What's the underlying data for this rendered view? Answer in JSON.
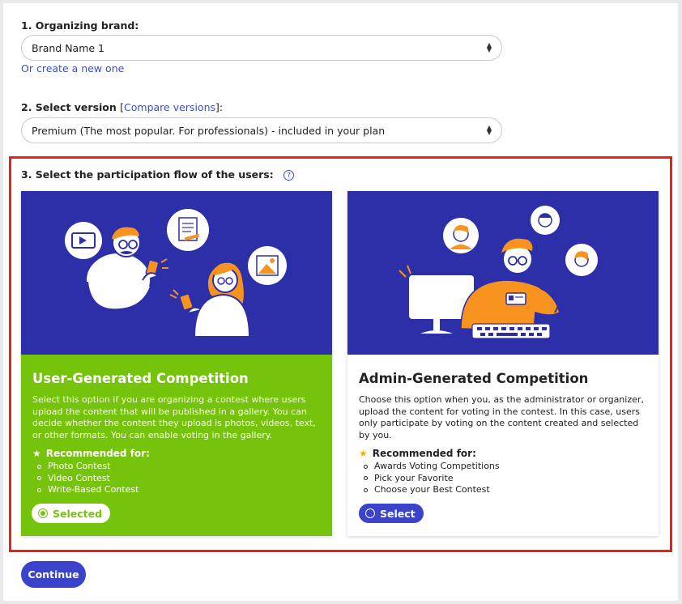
{
  "brand": {
    "label": "1. Organizing brand:",
    "selected": "Brand Name 1",
    "create_link": "Or create a new one"
  },
  "version": {
    "label": "2. Select version",
    "compare_open": "[",
    "compare_link": "Compare versions",
    "compare_close": "]:",
    "selected": "Premium (The most popular. For professionals) - included in your plan"
  },
  "flow": {
    "label": "3. Select the participation flow of the users:",
    "help": "?",
    "cards": [
      {
        "title": "User-Generated Competition",
        "description": "Select this option if you are organizing a contest where users upload the content that will be published in a gallery. You can decide whether the content they upload is photos, videos, text, or other formats. You can enable voting in the gallery.",
        "recommended_label": "Recommended for:",
        "items": [
          "Photo Contest",
          "Video Contest",
          "Write-Based Contest"
        ],
        "button": "Selected",
        "state": "selected"
      },
      {
        "title": "Admin-Generated Competition",
        "description": "Choose this option when you, as the administrator or organizer, upload the content for voting in the contest. In this case, users only participate by voting on the content created and selected by you.",
        "recommended_label": "Recommended for:",
        "items": [
          "Awards Voting Competitions",
          "Pick your Favorite",
          "Choose your Best Contest"
        ],
        "button": "Select",
        "state": "unselected"
      }
    ]
  },
  "continue_label": "Continue",
  "colors": {
    "primary": "#3a43c9",
    "green": "#75c40b",
    "illustration_bg": "#2c2fa7",
    "highlight": "#e4241b",
    "accent_orange": "#f7931e",
    "link": "#3c4fc4"
  }
}
